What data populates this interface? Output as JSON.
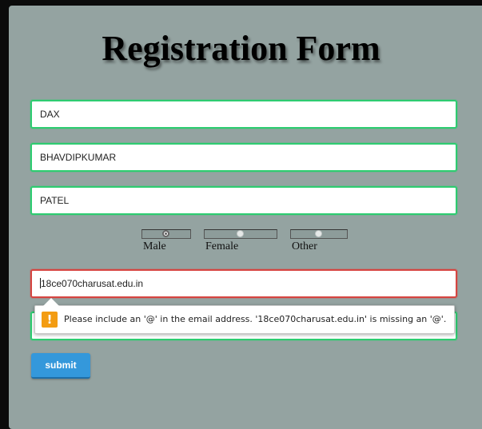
{
  "form": {
    "title": "Registration Form",
    "first_name": "DAX",
    "middle_name": "BHAVDIPKUMAR",
    "last_name": "PATEL",
    "gender": {
      "options": [
        "Male",
        "Female",
        "Other"
      ],
      "selected": "Male"
    },
    "email": "18ce070charusat.edu.in",
    "submit_label": "submit"
  },
  "validation": {
    "icon": "warning-icon",
    "icon_glyph": "!",
    "message": "Please include an '@' in the email address. '18ce070charusat.edu.in' is missing an '@'."
  },
  "colors": {
    "card_background": "#94a3a1",
    "valid_border": "#2ecc71",
    "invalid_border": "#d64541",
    "button": "#3498db",
    "warning": "#f39c12"
  }
}
